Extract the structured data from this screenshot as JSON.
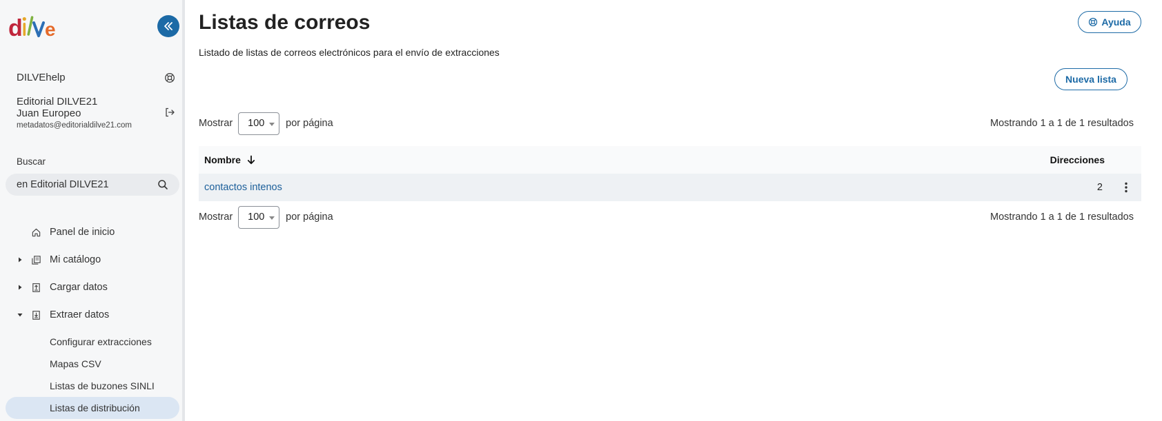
{
  "brand": {
    "logo_text": "dilve",
    "colors": {
      "d": "#c0263c",
      "i": "#e5a82a",
      "l": "#7fb241",
      "v": "#2c6fb5",
      "e": "#e56a2a",
      "accent": "#1c6aa6"
    }
  },
  "sidebar": {
    "collapse_icon": "chevrons-left-icon",
    "help_label": "DILVEhelp",
    "help_icon": "lifebuoy-icon",
    "user": {
      "company": "Editorial DILVE21",
      "name": "Juan Europeo",
      "email": "metadatos@editorialdilve21.com",
      "logout_icon": "logout-icon"
    },
    "search": {
      "label": "Buscar",
      "placeholder": "en Editorial DILVE21",
      "icon": "search-icon"
    },
    "nav": [
      {
        "label": "Panel de inicio",
        "icon": "home-icon"
      },
      {
        "label": "Mi catálogo",
        "icon": "catalog-icon",
        "expandable": true
      },
      {
        "label": "Cargar datos",
        "icon": "upload-icon",
        "expandable": true
      },
      {
        "label": "Extraer datos",
        "icon": "download-icon",
        "expanded": true
      }
    ],
    "subnav": [
      {
        "label": "Configurar extracciones"
      },
      {
        "label": "Mapas CSV"
      },
      {
        "label": "Listas de buzones SINLI"
      },
      {
        "label": "Listas de distribución",
        "active": true
      }
    ]
  },
  "main": {
    "title": "Listas de correos",
    "subtitle": "Listado de listas de correos electrónicos para el envío de extracciones",
    "help_button": "Ayuda",
    "new_button": "Nueva lista",
    "pager": {
      "show_label": "Mostrar",
      "per_page_value": "100",
      "per_page_label": "por página",
      "summary": "Mostrando 1 a 1 de 1 resultados"
    },
    "table": {
      "columns": {
        "name": "Nombre",
        "addresses": "Direcciones"
      },
      "rows": [
        {
          "name": "contactos intenos",
          "addresses": "2"
        }
      ]
    }
  }
}
